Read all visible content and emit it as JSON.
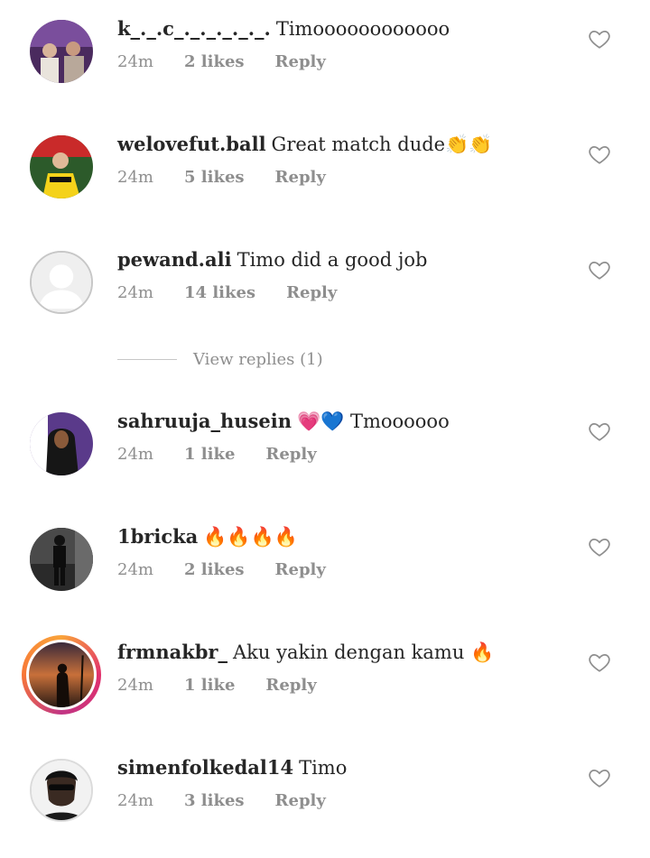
{
  "comments": [
    {
      "username": "k_._.c_._._._._._.",
      "text": "Timoooooooooooo",
      "time": "24m",
      "likes": "2 likes",
      "reply": "Reply",
      "avatar": "avatar-group-photo"
    },
    {
      "username": "welovefut.ball",
      "text": "Great match dude👏👏",
      "time": "24m",
      "likes": "5 likes",
      "reply": "Reply",
      "avatar": "avatar-football-player"
    },
    {
      "username": "pewand.ali",
      "text": "Timo did a good job",
      "time": "24m",
      "likes": "14 likes",
      "reply": "Reply",
      "avatar": "avatar-default"
    },
    {
      "username": "sahruuja_husein",
      "text": "💗💙 Tmoooooo",
      "time": "24m",
      "likes": "1 like",
      "reply": "Reply",
      "avatar": "avatar-person-hijab"
    },
    {
      "username": "1bricka",
      "text": "🔥🔥🔥🔥",
      "time": "24m",
      "likes": "2 likes",
      "reply": "Reply",
      "avatar": "avatar-person-standing"
    },
    {
      "username": "frmnakbr_",
      "text": "Aku yakin dengan kamu 🔥",
      "time": "24m",
      "likes": "1 like",
      "reply": "Reply",
      "avatar": "avatar-sunset-silhouette"
    },
    {
      "username": "simenfolkedal14",
      "text": "Timo",
      "time": "24m",
      "likes": "3 likes",
      "reply": "Reply",
      "avatar": "avatar-man-sunglasses"
    }
  ],
  "view_replies": "View replies (1)",
  "icons": {
    "like": "heart-outline-icon"
  },
  "colors": {
    "meta": "#8e8e8e",
    "text": "#262626",
    "story_ring": "#e1306c"
  }
}
